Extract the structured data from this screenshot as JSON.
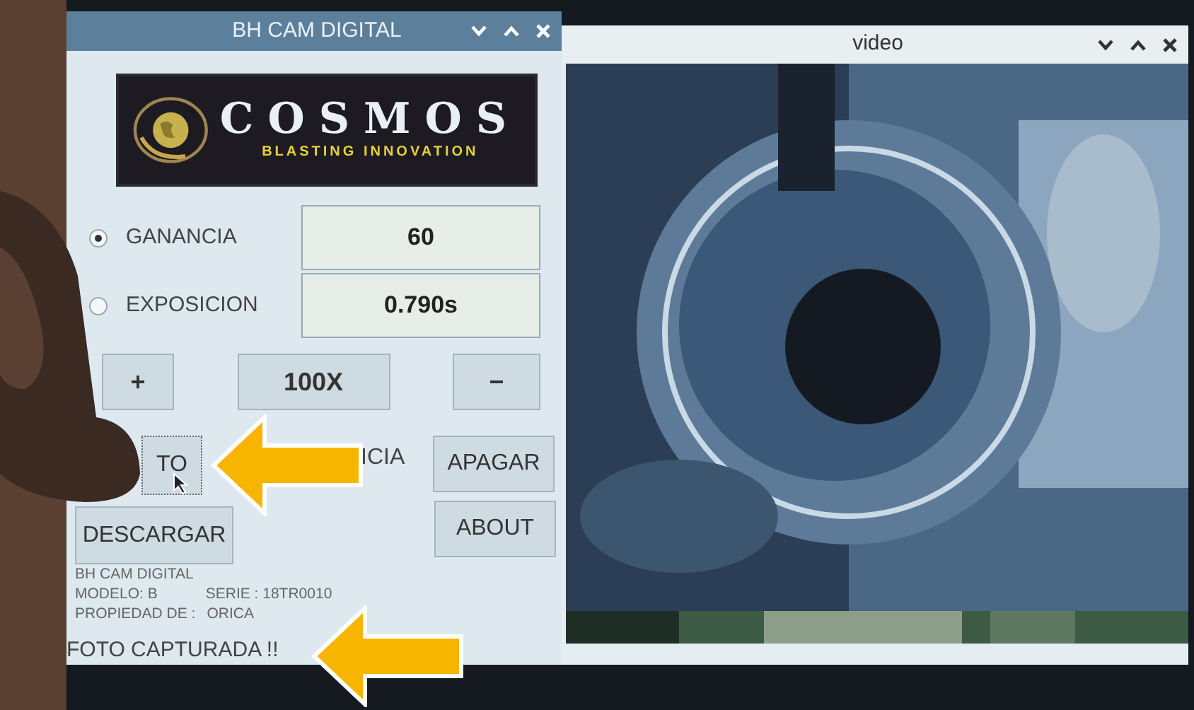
{
  "control_window": {
    "title": "BH CAM DIGITAL",
    "logo": {
      "name": "COSMOS",
      "tagline": "BLASTING INNOVATION"
    },
    "modes": [
      {
        "label": "GANANCIA",
        "selected": true,
        "value": "60"
      },
      {
        "label": "EXPOSICION",
        "selected": false,
        "value": "0.790s"
      }
    ],
    "zoom_buttons": [
      "+",
      "100X",
      "−"
    ],
    "capture_button": "TO",
    "partial_label": "ICIA",
    "off_button": "APAGAR",
    "download_button": "DESCARGAR",
    "about_button": "ABOUT",
    "info": {
      "name": "BH CAM DIGITAL",
      "model": "MODELO: B",
      "serial": "SERIE : 18TR0010",
      "owner_label": "PROPIEDAD DE :",
      "owner": "ORICA"
    },
    "status": "FOTO CAPTURADA !!"
  },
  "video_window": {
    "title": "video"
  }
}
